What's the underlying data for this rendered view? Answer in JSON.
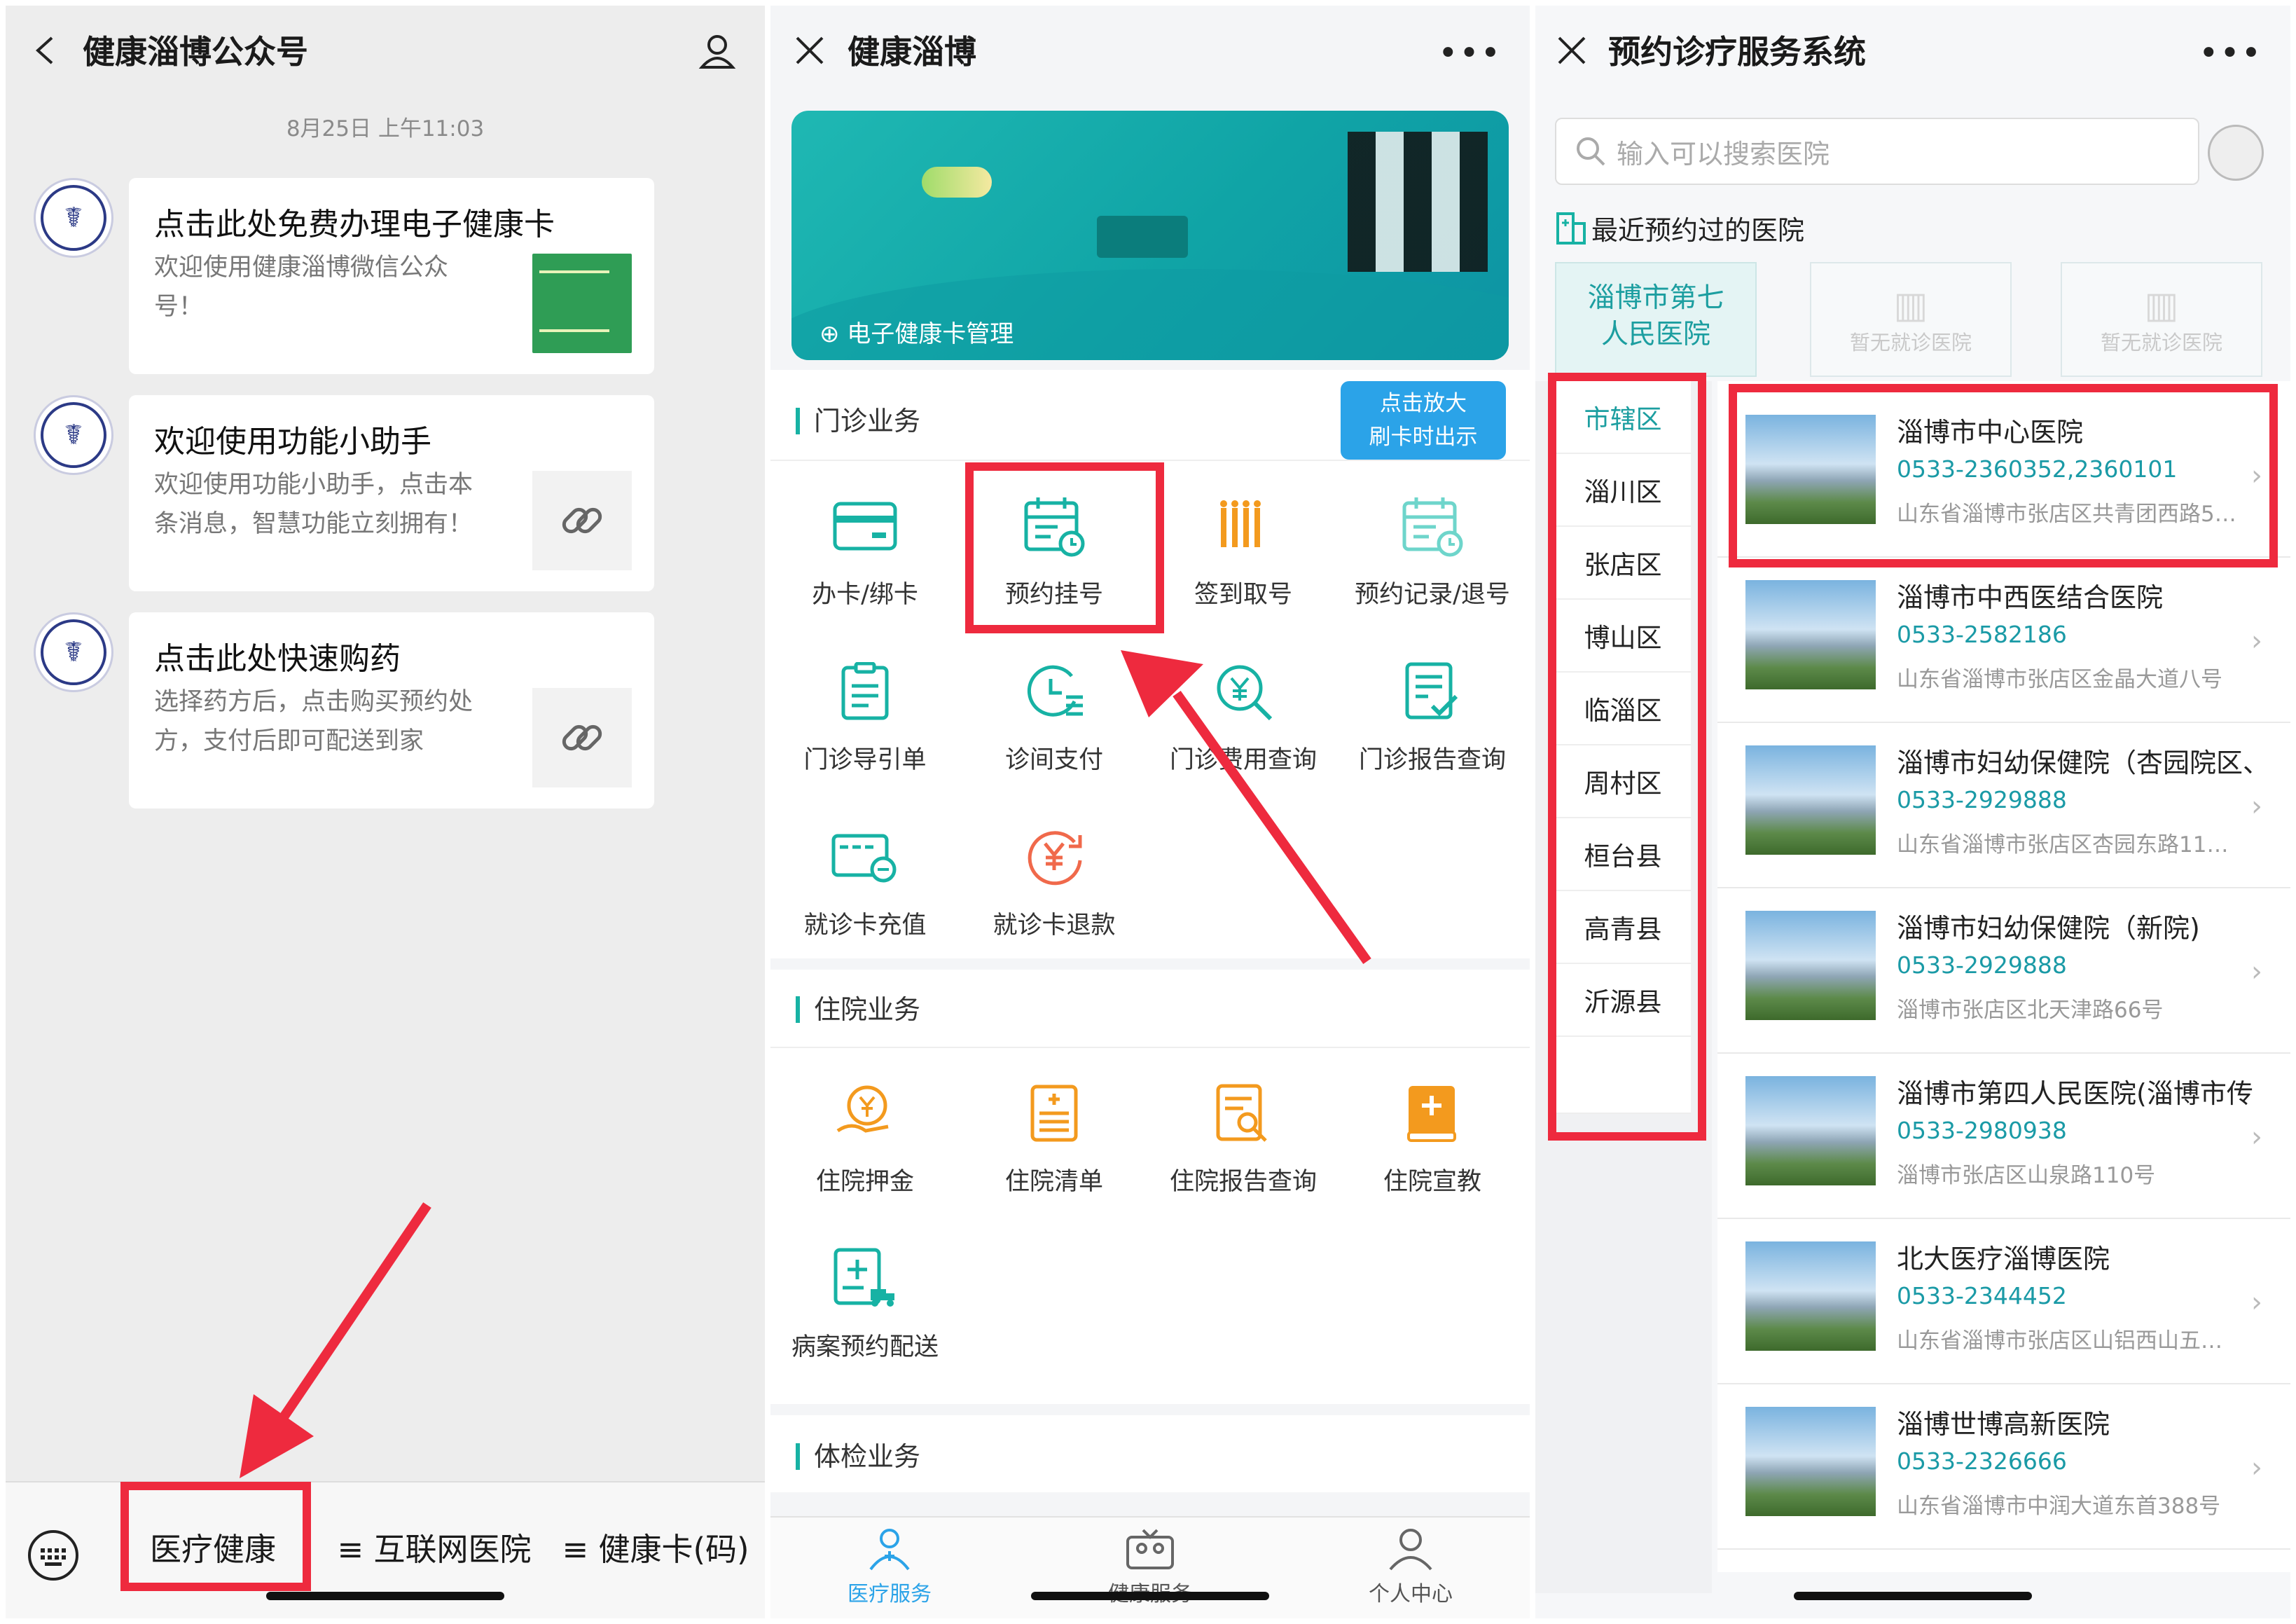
{
  "panel1": {
    "title": "健康淄博公众号",
    "date": "8月25日 上午11:03",
    "messages": [
      {
        "title": "点击此处免费办理电子健康卡",
        "desc": "欢迎使用健康淄博微信公众号！"
      },
      {
        "title": "欢迎使用功能小助手",
        "desc": "欢迎使用功能小助手，点击本条消息，智慧功能立刻拥有！"
      },
      {
        "title": "点击此处快速购药",
        "desc": "选择药方后，点击购买预约处方，支付后即可配送到家"
      }
    ],
    "menu": [
      "医疗健康",
      "≡ 互联网医院",
      "≡ 健康卡(码)"
    ]
  },
  "panel2": {
    "title": "健康淄博",
    "card_manage": "电子健康卡管理",
    "zoom_tip_1": "点击放大",
    "zoom_tip_2": "刷卡时出示",
    "outpatient": {
      "title": "门诊业务",
      "items": [
        "办卡/绑卡",
        "预约挂号",
        "签到取号",
        "预约记录/退号",
        "门诊导引单",
        "诊间支付",
        "门诊费用查询",
        "门诊报告查询",
        "就诊卡充值",
        "就诊卡退款"
      ]
    },
    "inpatient": {
      "title": "住院业务",
      "items": [
        "住院押金",
        "住院清单",
        "住院报告查询",
        "住院宣教",
        "病案预约配送"
      ]
    },
    "checkup_title": "体检业务",
    "nav": [
      "医疗服务",
      "健康服务",
      "个人中心"
    ],
    "colors": {
      "teal": "#17b2a4",
      "orange": "#f39a1e",
      "blue": "#2ba3e8"
    }
  },
  "panel3": {
    "title": "预约诊疗服务系统",
    "search_placeholder": "输入可以搜索医院",
    "recent_title": "最近预约过的医院",
    "recent": [
      "淄博市第七人民医院",
      "暂无就诊医院",
      "暂无就诊医院"
    ],
    "districts": [
      "市辖区",
      "淄川区",
      "张店区",
      "博山区",
      "临淄区",
      "周村区",
      "桓台县",
      "高青县",
      "沂源县"
    ],
    "hospitals": [
      {
        "name": "淄博市中心医院",
        "phone": "0533-2360352,2360101",
        "addr": "山东省淄博市张店区共青团西路5…"
      },
      {
        "name": "淄博市中西医结合医院",
        "phone": "0533-2582186",
        "addr": "山东省淄博市张店区金晶大道八号"
      },
      {
        "name": "淄博市妇幼保健院（杏园院区、",
        "phone": "0533-2929888",
        "addr": "山东省淄博市张店区杏园东路11…"
      },
      {
        "name": "淄博市妇幼保健院（新院)",
        "phone": "0533-2929888",
        "addr": "淄博市张店区北天津路66号"
      },
      {
        "name": "淄博市第四人民医院(淄博市传",
        "phone": "0533-2980938",
        "addr": "淄博市张店区山泉路110号"
      },
      {
        "name": "北大医疗淄博医院",
        "phone": "0533-2344452",
        "addr": "山东省淄博市张店区山铝西山五…"
      },
      {
        "name": "淄博世博高新医院",
        "phone": "0533-2326666",
        "addr": "山东省淄博市中润大道东首388号"
      }
    ],
    "accent": "#1c9ea0"
  },
  "highlight_color": "#ee2a3e"
}
